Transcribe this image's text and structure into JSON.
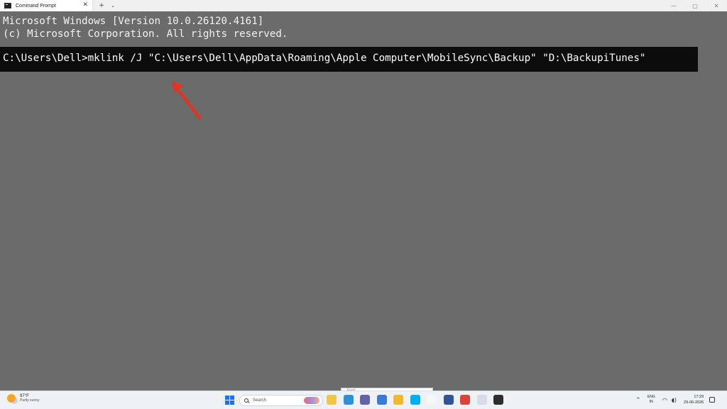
{
  "window": {
    "tab_title": "Command Prompt",
    "close_glyph": "✕",
    "new_tab_glyph": "+",
    "dropdown_glyph": "⌄",
    "minimize_glyph": "—",
    "maximize_glyph": "▢",
    "window_close_glyph": "✕"
  },
  "console": {
    "line1": "Microsoft Windows [Version 10.0.26120.4161]",
    "line2": "(c) Microsoft Corporation. All rights reserved.",
    "command": "C:\\Users\\Dell>mklink /J \"C:\\Users\\Dell\\AppData\\Roaming\\Apple Computer\\MobileSync\\Backup\" \"D:\\BackupiTunes\"",
    "highlight_color": "#0c0c0c",
    "text_color": "#f2f2f2",
    "background_color": "#6b6b6b",
    "annotation_arrow_color": "#e8321e"
  },
  "taskbar": {
    "weather_temp": "97°F",
    "weather_desc": "Partly sunny",
    "search_label": "Search",
    "peek_text": "Feed",
    "apps": [
      {
        "icon": "file-explorer-icon",
        "color": "#f4c542"
      },
      {
        "icon": "edge-icon",
        "color": "#2f8fd8"
      },
      {
        "icon": "teams-icon",
        "color": "#6264a7"
      },
      {
        "icon": "store-icon",
        "color": "#3a7bd5"
      },
      {
        "icon": "folder-icon",
        "color": "#f2b632"
      },
      {
        "icon": "skype-icon",
        "color": "#00aff0"
      },
      {
        "icon": "notepad-icon",
        "color": "#f6f6f6"
      },
      {
        "icon": "word-icon",
        "color": "#2b579a"
      },
      {
        "icon": "chrome-icon",
        "color": "#db4437"
      },
      {
        "icon": "itunes-icon",
        "color": "#d9d9e8"
      },
      {
        "icon": "terminal-icon",
        "color": "#2d2d2d"
      }
    ],
    "tray_chevron": "^",
    "lang_top": "ENG",
    "lang_bottom": "IN",
    "wifi_glyph": "◠",
    "volume_glyph": "◖)",
    "time": "17:29",
    "date": "29-06-2026"
  }
}
